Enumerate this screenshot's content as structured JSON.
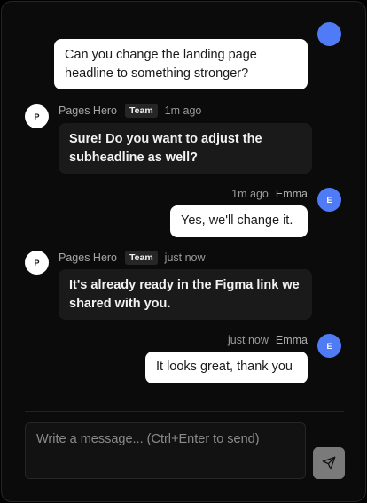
{
  "colors": {
    "background": "#0b0b0b",
    "bot_bubble": "#1a1a1a",
    "user_bubble": "#ffffff",
    "user_avatar": "#4f7cf6",
    "bot_avatar": "#ffffff",
    "send_button": "#7a7a7a"
  },
  "messages": [
    {
      "sender": "user",
      "text": "Can you change the landing page headline to something stronger?"
    },
    {
      "sender": "bot",
      "avatar_initial": "P",
      "name": "Pages Hero",
      "badge": "Team",
      "time": "1m ago",
      "text": "Sure! Do you want to adjust the subheadline as well?"
    },
    {
      "sender": "user",
      "avatar_initial": "E",
      "name": "Emma",
      "time": "1m ago",
      "text": "Yes, we'll change it."
    },
    {
      "sender": "bot",
      "avatar_initial": "P",
      "name": "Pages Hero",
      "badge": "Team",
      "time": "just now",
      "text": "It's already ready in the Figma link we shared with you."
    },
    {
      "sender": "user",
      "avatar_initial": "E",
      "name": "Emma",
      "time": "just now",
      "text": "It looks great, thank you"
    }
  ],
  "composer": {
    "placeholder": "Write a message... (Ctrl+Enter to send)",
    "value": ""
  },
  "icons": {
    "send": "send-icon",
    "avatar": "avatar"
  }
}
